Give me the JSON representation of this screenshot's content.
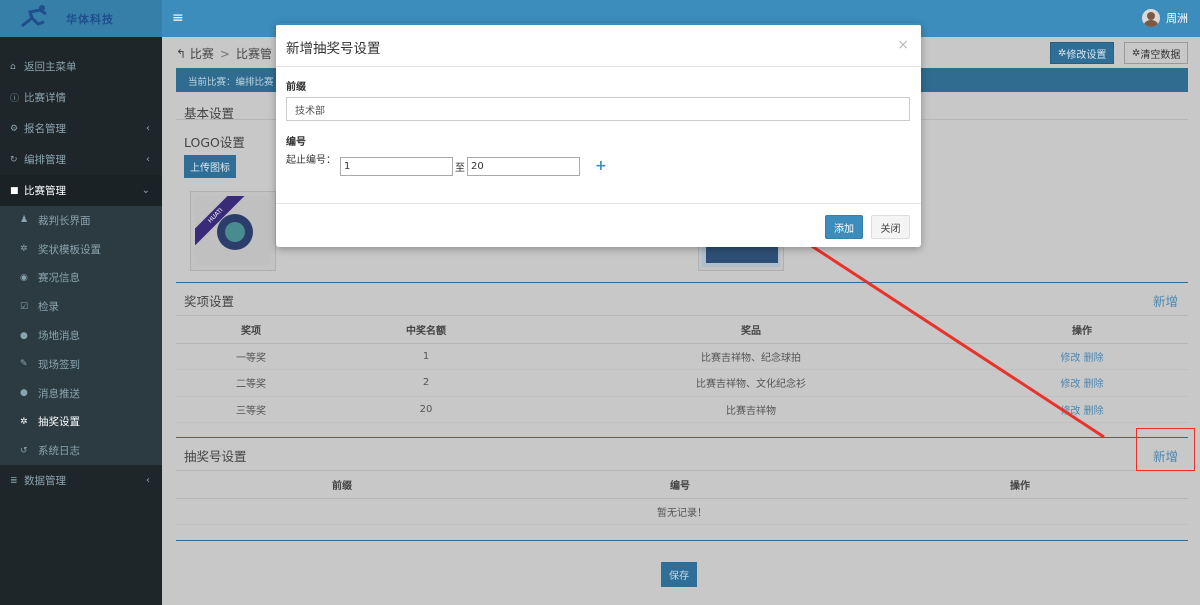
{
  "topbar": {
    "logo_text": "华体科技",
    "menu_icon": "hamburger-icon",
    "user_name": "周洲"
  },
  "sidebar": {
    "items": [
      {
        "label": "返回主菜单",
        "icon": "home-icon"
      },
      {
        "label": "比赛详情",
        "icon": "info-icon"
      },
      {
        "label": "报名管理",
        "icon": "cogs-icon"
      },
      {
        "label": "编排管理",
        "icon": "refresh-icon"
      },
      {
        "label": "比赛管理",
        "icon": "book-icon"
      },
      {
        "label": "数据管理",
        "icon": "database-icon"
      }
    ],
    "sub_items": [
      {
        "label": "裁判长界面",
        "icon": "user-icon"
      },
      {
        "label": "奖状模板设置",
        "icon": "gear-icon"
      },
      {
        "label": "赛况信息",
        "icon": "eye-icon"
      },
      {
        "label": "检录",
        "icon": "checkbox-icon"
      },
      {
        "label": "场地消息",
        "icon": "comment-icon"
      },
      {
        "label": "现场签到",
        "icon": "edit-icon"
      },
      {
        "label": "消息推送",
        "icon": "comment-icon"
      },
      {
        "label": "抽奖设置",
        "icon": "gear-icon"
      },
      {
        "label": "系统日志",
        "icon": "history-icon"
      }
    ]
  },
  "header": {
    "crumb_1": "比赛",
    "crumb_2": "比赛管",
    "modify_button": "修改设置",
    "clear_button": "清空数据",
    "notice": "当前比赛：编排比赛"
  },
  "basic": {
    "title": "基本设置",
    "logo_label": "LOGO设置",
    "upload_button": "上传图标",
    "logo_badge_text": "HUATI"
  },
  "prize": {
    "title": "奖项设置",
    "add_link": "新增",
    "columns": [
      "奖项",
      "中奖名额",
      "奖品",
      "操作"
    ],
    "rows": [
      {
        "name": "一等奖",
        "count": "1",
        "gift": "比赛吉祥物、纪念球拍",
        "edit": "修改",
        "delete": "删除"
      },
      {
        "name": "二等奖",
        "count": "2",
        "gift": "比赛吉祥物、文化纪念衫",
        "edit": "修改",
        "delete": "删除"
      },
      {
        "name": "三等奖",
        "count": "20",
        "gift": "比赛吉祥物",
        "edit": "修改",
        "delete": "删除"
      }
    ]
  },
  "lottery": {
    "title": "抽奖号设置",
    "add_link": "新增",
    "columns": [
      "前缀",
      "编号",
      "操作"
    ],
    "empty": "暂无记录！"
  },
  "save_button": "保存",
  "modal": {
    "title": "新增抽奖号设置",
    "close_symbol": "×",
    "prefix_label": "前缀",
    "prefix_value": "技术部",
    "number_label": "编号",
    "range_label": "起止编号：",
    "start_value": "1",
    "to_label": "至",
    "end_value": "20",
    "add_button": "添加",
    "close_button": "关闭"
  },
  "colors": {
    "primary": "#3c8dbc",
    "sidebar": "#1f2629",
    "annotation": "#e8322a"
  }
}
